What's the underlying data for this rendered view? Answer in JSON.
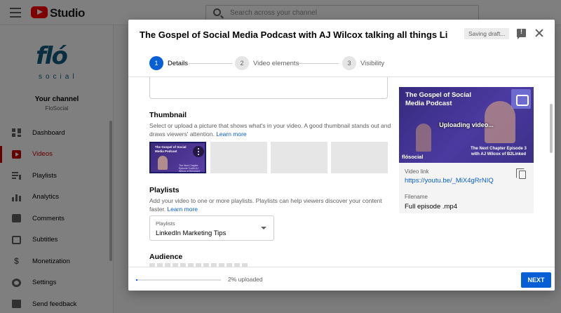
{
  "app": {
    "brand": "Studio",
    "search_placeholder": "Search across your channel"
  },
  "sidebar": {
    "logo_main": "fló",
    "logo_sub": "social",
    "channel_title": "Your channel",
    "channel_name": "FloSocial",
    "items": [
      {
        "label": "Dashboard",
        "icon": "dashboard-icon"
      },
      {
        "label": "Videos",
        "icon": "videos-icon",
        "active": true
      },
      {
        "label": "Playlists",
        "icon": "playlists-icon"
      },
      {
        "label": "Analytics",
        "icon": "analytics-icon"
      },
      {
        "label": "Comments",
        "icon": "comments-icon"
      },
      {
        "label": "Subtitles",
        "icon": "subtitles-icon"
      },
      {
        "label": "Monetization",
        "icon": "dollar-icon"
      },
      {
        "label": "Settings",
        "icon": "gear-icon"
      },
      {
        "label": "Send feedback",
        "icon": "feedback-icon"
      }
    ]
  },
  "dialog": {
    "title": "The Gospel of Social Media Podcast with AJ Wilcox talking all things Link...",
    "saving_status": "Saving draft...",
    "steps": [
      {
        "number": "1",
        "label": "Details"
      },
      {
        "number": "2",
        "label": "Video elements"
      },
      {
        "number": "3",
        "label": "Visibility"
      }
    ],
    "thumbnail": {
      "title": "Thumbnail",
      "description": "Select or upload a picture that shows what's in your video. A good thumbnail stands out and draws viewers' attention.",
      "learn_more": "Learn more",
      "selected_thumb_title": "The Gospel of Social Media Podcast",
      "selected_thumb_sub": "The Next Chapter Episode 3 with AJ Wilcox of B2Linked"
    },
    "playlists": {
      "title": "Playlists",
      "description": "Add your video to one or more playlists. Playlists can help viewers discover your content faster.",
      "learn_more": "Learn more",
      "select_label": "Playlists",
      "selected": "LinkedIn Marketing Tips"
    },
    "audience": {
      "title": "Audience"
    },
    "preview": {
      "video_title": "The Gospel of Social Media Podcast",
      "uploading_text": "Uploading video...",
      "video_subtitle": "The Next Chapter Episode 3 with AJ Wilcox of B2Linked",
      "logo_text": "flósocial",
      "video_link_label": "Video link",
      "video_link": "https://youtu.be/_MiX4gRrNIQ",
      "filename_label": "Filename",
      "filename": "Full episode .mp4"
    },
    "footer": {
      "upload_progress": 0.02,
      "upload_status": "2% uploaded",
      "next_label": "NEXT"
    }
  },
  "colors": {
    "accent": "#065fd4",
    "brand_red": "#ff0000",
    "active_nav": "#cc0000"
  }
}
